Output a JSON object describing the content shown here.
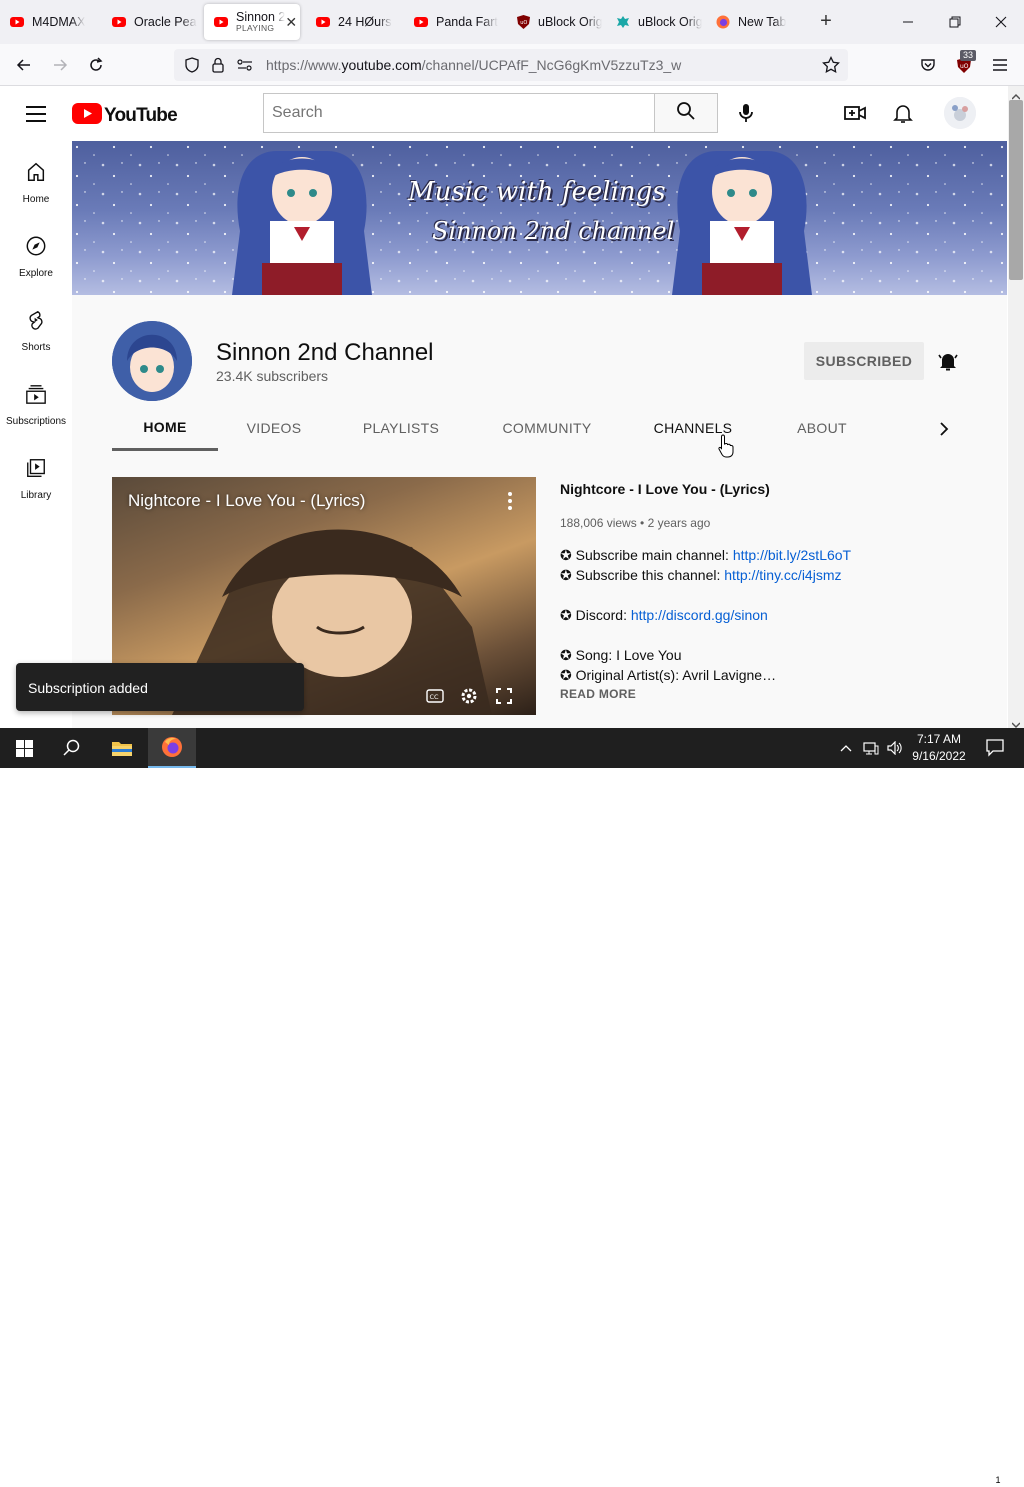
{
  "browser": {
    "tabs": [
      {
        "title": "M4DMAX",
        "icon": "youtube-icon"
      },
      {
        "title": "Oracle Pea",
        "icon": "youtube-icon"
      },
      {
        "title": "Sinnon 2",
        "subtitle": "PLAYING",
        "icon": "youtube-icon",
        "active": true
      },
      {
        "title": "24 HØurs",
        "icon": "youtube-icon"
      },
      {
        "title": "Panda Fart",
        "icon": "youtube-icon"
      },
      {
        "title": "uBlock Orig",
        "icon": "ublock-icon"
      },
      {
        "title": "uBlock Orig",
        "icon": "ublock-origin-teal-icon"
      },
      {
        "title": "New Tab",
        "icon": "firefox-icon"
      }
    ],
    "url_prefix": "https://www.",
    "url_domain": "youtube.com",
    "url_path": "/channel/UCPAfF_NcG6gKmV5zzuTz3_w",
    "extension_badge": "33"
  },
  "youtube": {
    "logo_text": "YouTube",
    "search_placeholder": "Search",
    "rail": [
      {
        "label": "Home",
        "icon": "home-icon"
      },
      {
        "label": "Explore",
        "icon": "compass-icon"
      },
      {
        "label": "Shorts",
        "icon": "shorts-icon"
      },
      {
        "label": "Subscriptions",
        "icon": "subscriptions-icon"
      },
      {
        "label": "Library",
        "icon": "library-icon"
      }
    ],
    "banner": {
      "line1": "Music with feelings",
      "line2": "Sinnon 2nd channel"
    },
    "channel": {
      "name": "Sinnon 2nd Channel",
      "subscribers": "23.4K subscribers",
      "subscribe_label": "SUBSCRIBED"
    },
    "tabs": [
      "HOME",
      "VIDEOS",
      "PLAYLISTS",
      "COMMUNITY",
      "CHANNELS",
      "ABOUT"
    ],
    "selected_tab": "HOME",
    "featured": {
      "overlay_title": "Nightcore - I Love You - (Lyrics)",
      "title": "Nightcore - I Love You - (Lyrics)",
      "views": "188,006 views",
      "age": "2 years ago",
      "lines": [
        {
          "prefix": "✪ Subscribe main channel: ",
          "link": "http://bit.ly/2stL6oT"
        },
        {
          "prefix": "✪ Subscribe this channel: ",
          "link": "http://tiny.cc/i4jsmz"
        },
        {
          "prefix": "",
          "link": ""
        },
        {
          "prefix": "✪ Discord: ",
          "link": "http://discord.gg/sinon"
        },
        {
          "prefix": "",
          "link": ""
        },
        {
          "prefix": "✪ Song: I Love You",
          "link": ""
        },
        {
          "prefix": "✪ Original Artist(s): Avril Lavigne…",
          "link": ""
        }
      ],
      "read_more": "READ MORE"
    },
    "toast": "Subscription added"
  },
  "taskbar": {
    "time": "7:17 AM",
    "date": "9/16/2022",
    "notification_count": "1"
  },
  "colors": {
    "youtube_red": "#ff0000",
    "link_blue": "#065fd4",
    "taskbar": "#1f1f1f"
  }
}
